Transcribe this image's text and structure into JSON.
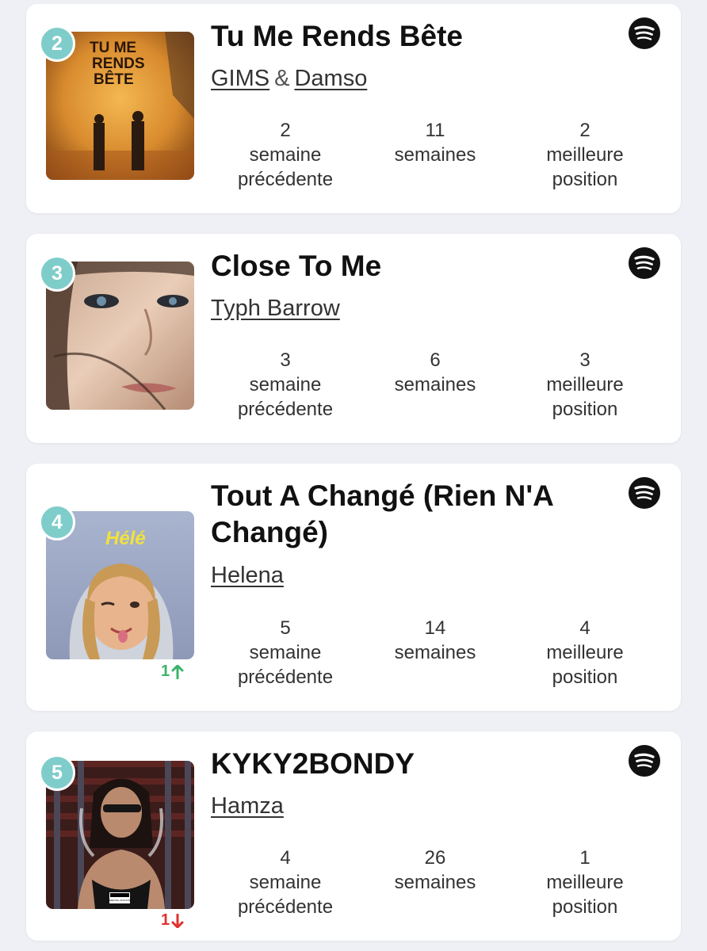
{
  "entries": [
    {
      "rank": "2",
      "title": "Tu Me Rends Bête",
      "artists": [
        "GIMS",
        "Damso"
      ],
      "artist_separator": "&",
      "cover_text": [
        "TU ME",
        "RENDS",
        "BÊTE"
      ],
      "stats": {
        "previous_value": "2",
        "previous_label": [
          "semaine",
          "précédente"
        ],
        "weeks_value": "11",
        "weeks_label": [
          "semaines"
        ],
        "best_value": "2",
        "best_label": [
          "meilleure",
          "position"
        ]
      }
    },
    {
      "rank": "3",
      "title": "Close To Me",
      "artists": [
        "Typh Barrow"
      ],
      "stats": {
        "previous_value": "3",
        "previous_label": [
          "semaine",
          "précédente"
        ],
        "weeks_value": "6",
        "weeks_label": [
          "semaines"
        ],
        "best_value": "3",
        "best_label": [
          "meilleure",
          "position"
        ]
      }
    },
    {
      "rank": "4",
      "title": "Tout A Changé (Rien N'A Changé)",
      "artists": [
        "Helena"
      ],
      "cover_text": [
        "Hélé"
      ],
      "movement": {
        "value": "1",
        "direction": "up",
        "color": "#3bb36a"
      },
      "stats": {
        "previous_value": "5",
        "previous_label": [
          "semaine",
          "précédente"
        ],
        "weeks_value": "14",
        "weeks_label": [
          "semaines"
        ],
        "best_value": "4",
        "best_label": [
          "meilleure",
          "position"
        ]
      }
    },
    {
      "rank": "5",
      "title": "KYKY2BONDY",
      "artists": [
        "Hamza"
      ],
      "cover_text": [
        "PARENTAL ADVISORY"
      ],
      "movement": {
        "value": "1",
        "direction": "down",
        "color": "#e0322e"
      },
      "stats": {
        "previous_value": "4",
        "previous_label": [
          "semaine",
          "précédente"
        ],
        "weeks_value": "26",
        "weeks_label": [
          "semaines"
        ],
        "best_value": "1",
        "best_label": [
          "meilleure",
          "position"
        ]
      }
    }
  ],
  "icons": {
    "streaming": "spotify-icon",
    "up": "arrow-up-icon",
    "down": "arrow-down-icon"
  },
  "colors": {
    "rank_badge": "#7fcdca",
    "card": "#ffffff",
    "background": "#eef0f5"
  }
}
